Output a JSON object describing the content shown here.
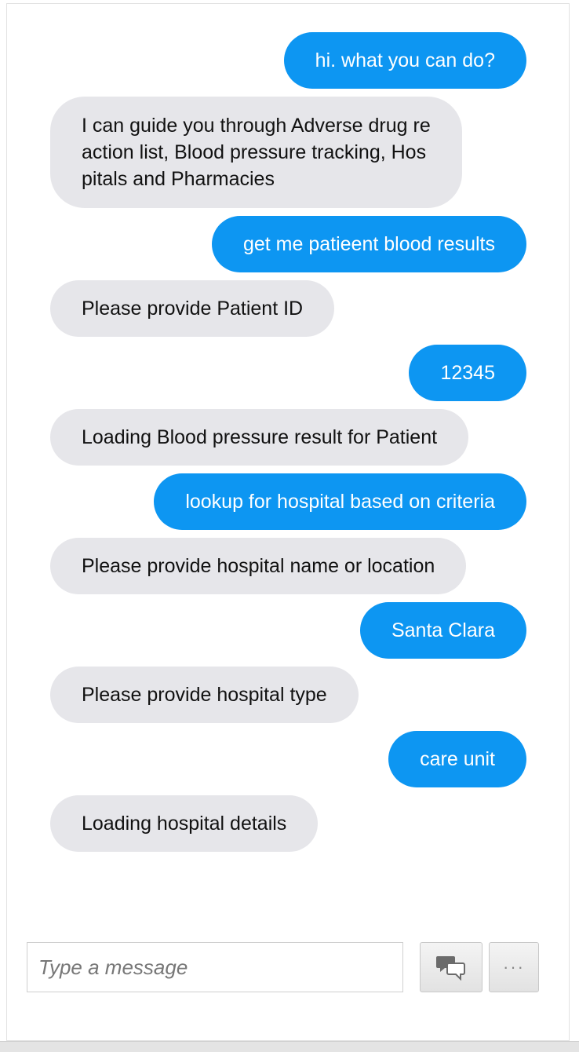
{
  "conversation": [
    {
      "role": "user",
      "text": "hi. what you can do?"
    },
    {
      "role": "bot",
      "text": "I can guide you through Adverse drug re\naction list, Blood pressure tracking, Hos\npitals and Pharmacies"
    },
    {
      "role": "user",
      "text": "get me patieent blood results"
    },
    {
      "role": "bot",
      "text": "Please provide Patient ID"
    },
    {
      "role": "user",
      "text": "12345"
    },
    {
      "role": "bot",
      "text": "Loading Blood pressure result for Patient"
    },
    {
      "role": "user",
      "text": "lookup for hospital based on criteria"
    },
    {
      "role": "bot",
      "text": "Please provide hospital name or location"
    },
    {
      "role": "user",
      "text": "Santa Clara"
    },
    {
      "role": "bot",
      "text": "Please provide hospital type"
    },
    {
      "role": "user",
      "text": "care unit"
    },
    {
      "role": "bot",
      "text": "Loading hospital details"
    }
  ],
  "composer": {
    "placeholder": "Type a message",
    "value": "",
    "send_icon": "chat-bubbles-icon",
    "more_label": "···"
  },
  "colors": {
    "user_bubble": "#0d96f2",
    "bot_bubble": "#e6e6ea"
  }
}
